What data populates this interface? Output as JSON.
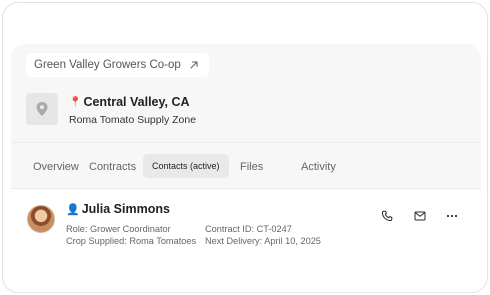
{
  "header": {
    "coop_name": "Green Valley Growers Co-op",
    "coop_link_icon": "arrow-up-right-icon"
  },
  "location": {
    "thumbnail_icon": "map-pin-icon",
    "title_emoji": "📍",
    "title": "Central Valley, CA",
    "subtitle": "Roma Tomato Supply Zone"
  },
  "tabs": [
    {
      "label": "Overview",
      "active": false
    },
    {
      "label": "Contracts",
      "active": false
    },
    {
      "label": "Contacts (active)",
      "active": true
    },
    {
      "label": "Files",
      "active": false
    },
    {
      "label": "Activity",
      "active": false
    }
  ],
  "contact": {
    "name_emoji": "👤",
    "name": "Julia Simmons",
    "role": "Role: Grower Coordinator",
    "crop": "Crop Supplied: Roma Tomatoes",
    "contract_id": "Contract ID: CT-0247",
    "next_delivery": "Next Delivery: April 10, 2025",
    "actions": [
      "phone-icon",
      "mail-icon",
      "more-horizontal-icon"
    ]
  },
  "colors": {
    "card_bg": "#f7f7f7",
    "active_tab_bg": "#e9e9e9",
    "text_primary": "#1f1f1f",
    "text_muted": "#666666"
  }
}
